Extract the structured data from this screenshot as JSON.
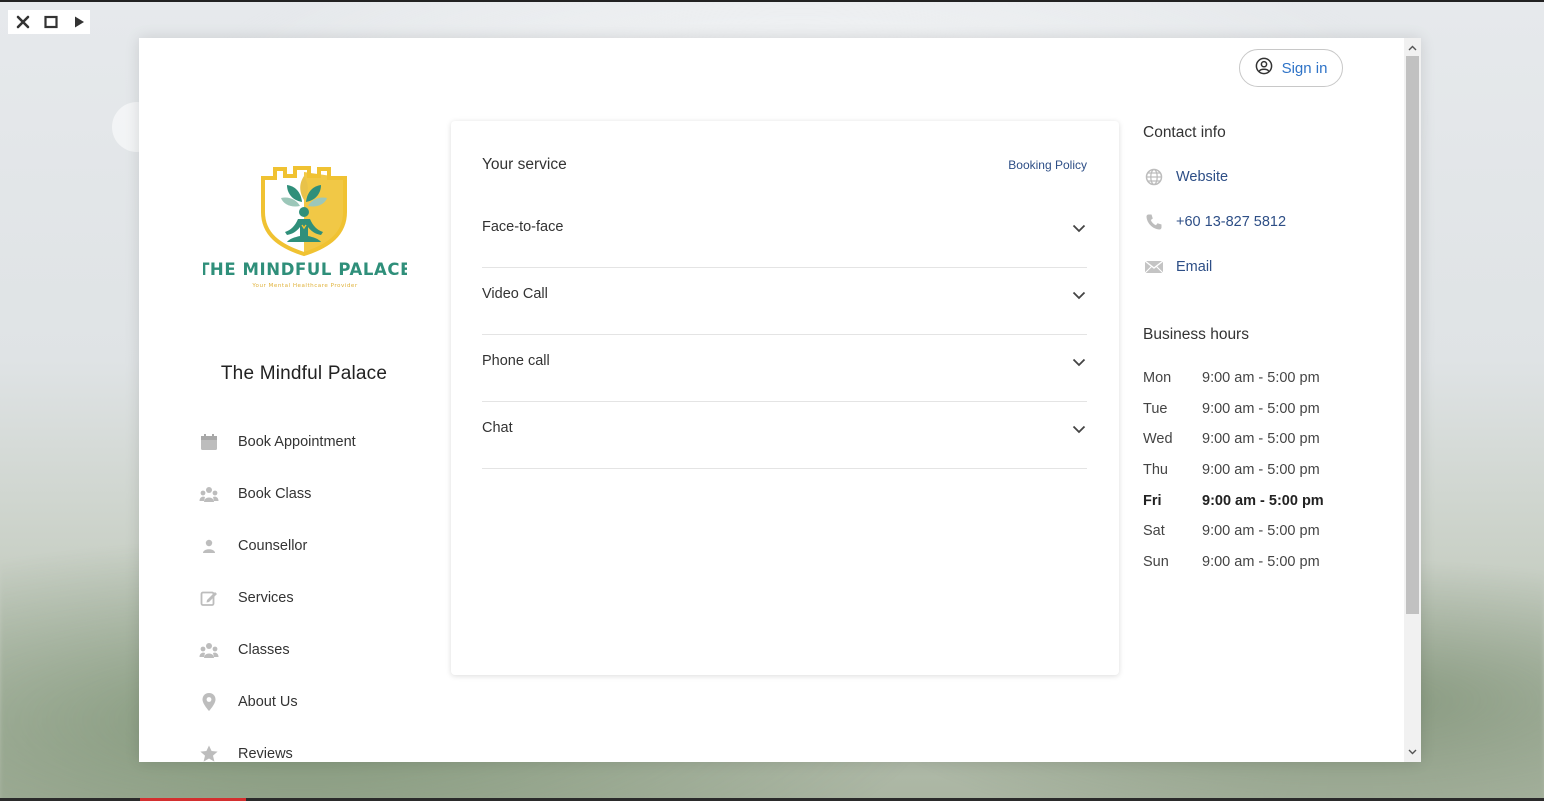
{
  "window_controls": {
    "close_icon": "close-icon",
    "maximize_icon": "maximize-icon",
    "play_icon": "play-icon"
  },
  "header": {
    "signin_label": "Sign in"
  },
  "business": {
    "logo_title": "THE MINDFUL PALACE",
    "logo_tagline": "Your Mental Healthcare Provider",
    "name": "The Mindful Palace"
  },
  "nav": {
    "items": [
      {
        "label": "Book Appointment",
        "icon": "calendar-icon"
      },
      {
        "label": "Book Class",
        "icon": "group-icon"
      },
      {
        "label": "Counsellor",
        "icon": "person-icon"
      },
      {
        "label": "Services",
        "icon": "edit-icon"
      },
      {
        "label": "Classes",
        "icon": "group-icon"
      },
      {
        "label": "About Us",
        "icon": "location-pin-icon"
      },
      {
        "label": "Reviews",
        "icon": "star-icon"
      }
    ]
  },
  "service": {
    "title": "Your service",
    "policy_label": "Booking Policy",
    "options": [
      {
        "label": "Face-to-face"
      },
      {
        "label": "Video Call"
      },
      {
        "label": "Phone call"
      },
      {
        "label": "Chat"
      }
    ]
  },
  "contact": {
    "title": "Contact info",
    "items": [
      {
        "label": "Website",
        "icon": "globe-icon"
      },
      {
        "label": "+60 13-827 5812",
        "icon": "phone-icon"
      },
      {
        "label": "Email",
        "icon": "envelope-icon"
      }
    ]
  },
  "hours": {
    "title": "Business hours",
    "days": [
      {
        "day": "Mon",
        "time": "9:00 am - 5:00 pm"
      },
      {
        "day": "Tue",
        "time": "9:00 am - 5:00 pm"
      },
      {
        "day": "Wed",
        "time": "9:00 am - 5:00 pm"
      },
      {
        "day": "Thu",
        "time": "9:00 am - 5:00 pm"
      },
      {
        "day": "Fri",
        "time": "9:00 am - 5:00 pm",
        "today": true
      },
      {
        "day": "Sat",
        "time": "9:00 am - 5:00 pm"
      },
      {
        "day": "Sun",
        "time": "9:00 am - 5:00 pm"
      }
    ]
  },
  "colors": {
    "link_blue": "#2d4e86",
    "signin_blue": "#2e73c7",
    "logo_teal": "#2f8f7a",
    "logo_gold": "#f0c232"
  }
}
